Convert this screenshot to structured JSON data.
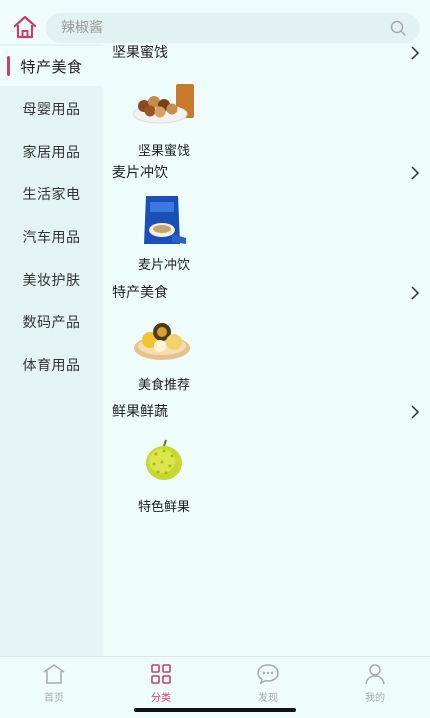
{
  "search": {
    "placeholder": "辣椒酱"
  },
  "sidebar": {
    "items": [
      {
        "label": "特产美食",
        "active": true
      },
      {
        "label": "母婴用品"
      },
      {
        "label": "家居用品"
      },
      {
        "label": "生活家电"
      },
      {
        "label": "汽车用品"
      },
      {
        "label": "美妆护肤"
      },
      {
        "label": "数码产品"
      },
      {
        "label": "体育用品"
      }
    ]
  },
  "sections": [
    {
      "title": "坚果蜜饯",
      "product": "坚果蜜饯",
      "icon": "nuts-icon"
    },
    {
      "title": "麦片冲饮",
      "product": "麦片冲饮",
      "icon": "cereal-bag-icon"
    },
    {
      "title": "特产美食",
      "product": "美食推荐",
      "icon": "food-plate-icon"
    },
    {
      "title": "鲜果鲜蔬",
      "product": "特色鲜果",
      "icon": "durian-icon"
    }
  ],
  "tabbar": {
    "tabs": [
      {
        "label": "首页",
        "icon": "home-icon"
      },
      {
        "label": "分类",
        "icon": "grid-icon",
        "active": true
      },
      {
        "label": "发现",
        "icon": "chat-icon"
      },
      {
        "label": "我的",
        "icon": "user-icon"
      }
    ]
  },
  "colors": {
    "accent": "#c9406c",
    "background": "#eefcfc",
    "sidebar": "#e4f4f4"
  }
}
